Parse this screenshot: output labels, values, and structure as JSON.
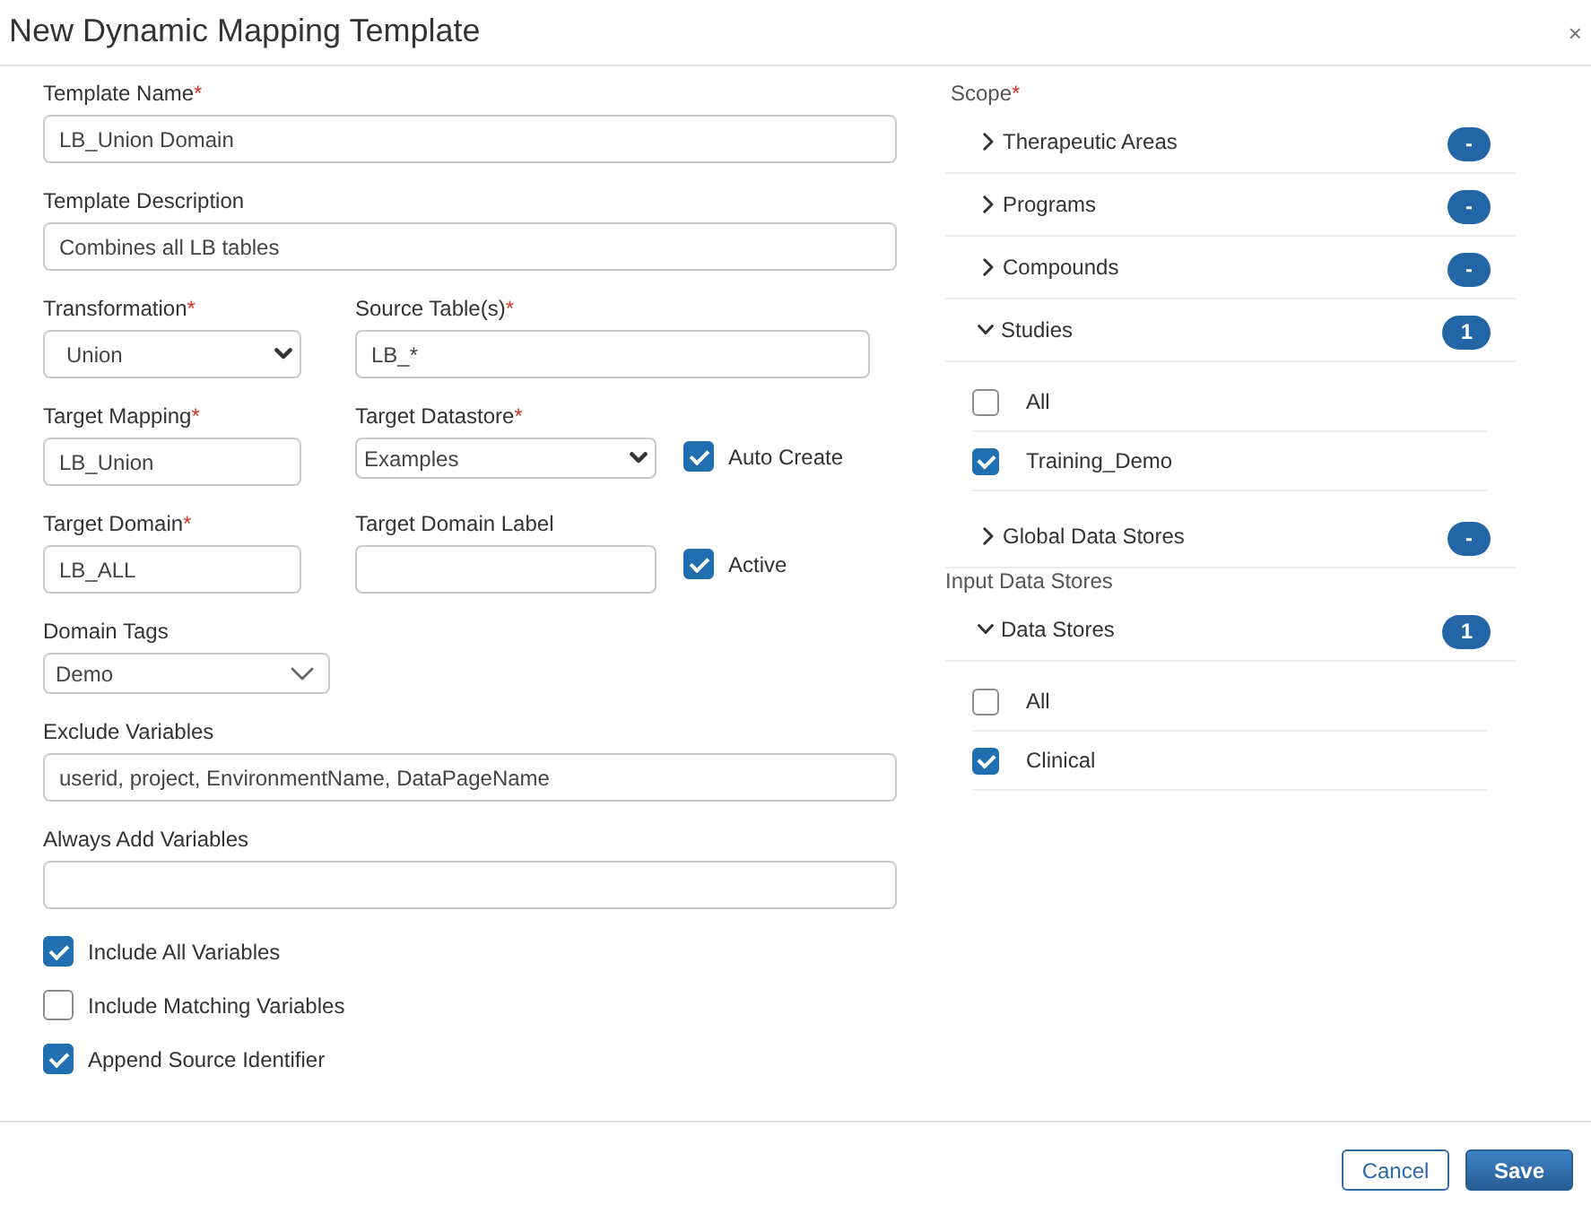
{
  "dialog": {
    "title": "New Dynamic Mapping Template",
    "close": "×"
  },
  "form": {
    "template_name": {
      "label": "Template Name",
      "required_mark": "*",
      "kind": "text",
      "value": "LB_Union Domain"
    },
    "template_description": {
      "label": "Template Description",
      "kind": "text",
      "value": "Combines all LB tables"
    },
    "transformation": {
      "label": "Transformation",
      "required_mark": "*",
      "kind": "select",
      "value": "Union"
    },
    "source_tables": {
      "label": "Source Table(s)",
      "required_mark": "*",
      "kind": "text",
      "value": "LB_*"
    },
    "target_mapping": {
      "label": "Target Mapping",
      "required_mark": "*",
      "kind": "text",
      "value": "LB_Union"
    },
    "target_datastore": {
      "label": "Target Datastore",
      "required_mark": "*",
      "kind": "select",
      "value": "Examples"
    },
    "auto_create": {
      "label": "Auto Create",
      "checked": true
    },
    "target_domain": {
      "label": "Target Domain",
      "required_mark": "*",
      "kind": "text",
      "value": "LB_ALL"
    },
    "target_domain_label": {
      "label": "Target Domain Label",
      "kind": "text"
    },
    "active": {
      "label": "Active",
      "checked": true
    },
    "domain_tags": {
      "label": "Domain Tags",
      "kind": "select",
      "value": "Demo"
    },
    "exclude_variables": {
      "label": "Exclude Variables",
      "kind": "text",
      "value": "userid, project, EnvironmentName, DataPageName"
    },
    "always_add_variables": {
      "label": "Always Add Variables",
      "kind": "text"
    },
    "options": [
      {
        "label": "Include All Variables",
        "checked": true
      },
      {
        "label": "Include Matching Variables",
        "checked": false
      },
      {
        "label": "Append Source Identifier",
        "checked": true
      }
    ]
  },
  "scope": {
    "label": "Scope",
    "required_mark": "*",
    "groups": [
      {
        "label": "Therapeutic Areas",
        "expanded": false,
        "badge": "-"
      },
      {
        "label": "Programs",
        "expanded": false,
        "badge": "-"
      },
      {
        "label": "Compounds",
        "expanded": false,
        "badge": "-"
      },
      {
        "label": "Studies",
        "expanded": true,
        "badge": "1",
        "items": [
          {
            "label": "All",
            "checked": false
          },
          {
            "label": "Training_Demo",
            "checked": true
          }
        ]
      },
      {
        "label": "Global Data Stores",
        "expanded": false,
        "badge": "-"
      }
    ]
  },
  "input_data_stores": {
    "label": "Input Data Stores",
    "groups": [
      {
        "label": "Data Stores",
        "expanded": true,
        "badge": "1",
        "items": [
          {
            "label": "All",
            "checked": false
          },
          {
            "label": "Clinical",
            "checked": true
          }
        ]
      }
    ]
  },
  "buttons": [
    {
      "label": "Cancel",
      "kind": "secondary"
    },
    {
      "label": "Save",
      "kind": "primary"
    }
  ]
}
